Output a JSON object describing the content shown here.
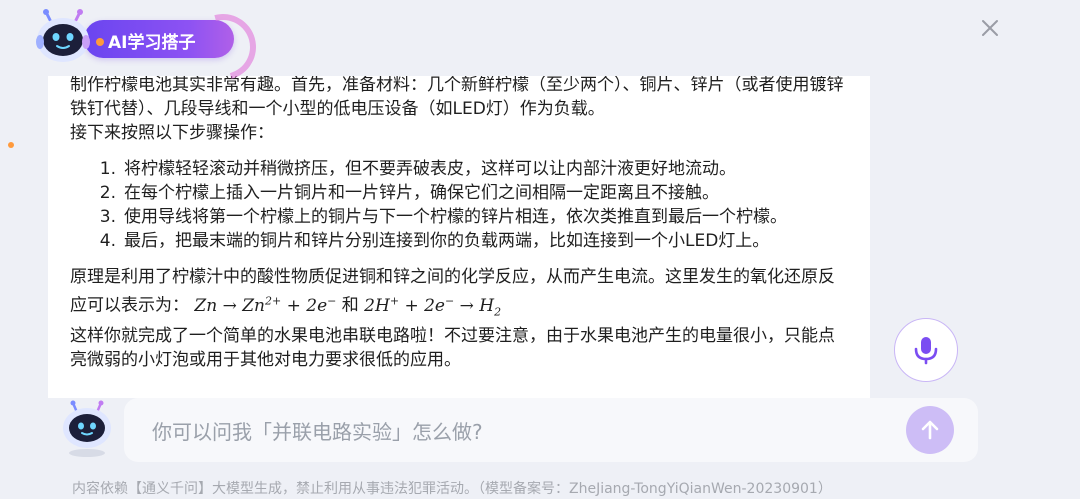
{
  "header": {
    "title": "AI学习搭子",
    "logo_icon": "robot-mascot-icon",
    "close_icon": "close-icon"
  },
  "content": {
    "intro_paragraph": "制作柠檬电池其实非常有趣。首先，准备材料：几个新鲜柠檬（至少两个）、铜片、锌片（或者使用镀锌铁钉代替）、几段导线和一个小型的低电压设备（如LED灯）作为负载。",
    "steps_intro": "接下来按照以下步骤操作：",
    "steps": [
      {
        "num": "1.",
        "text": "将柠檬轻轻滚动并稍微挤压，但不要弄破表皮，这样可以让内部汁液更好地流动。"
      },
      {
        "num": "2.",
        "text": "在每个柠檬上插入一片铜片和一片锌片，确保它们之间相隔一定距离且不接触。"
      },
      {
        "num": "3.",
        "text": "使用导线将第一个柠檬上的铜片与下一个柠檬的锌片相连，依次类推直到最后一个柠檬。"
      },
      {
        "num": "4.",
        "text": "最后，把最末端的铜片和锌片分别连接到你的负载两端，比如连接到一个小LED灯上。"
      }
    ],
    "principle_text": "原理是利用了柠檬汁中的酸性物质促进铜和锌之间的化学反应，从而产生电流。这里发生的氧化还原反应可以表示为：",
    "formula_conjunction": "和",
    "conclusion": "这样你就完成了一个简单的水果电池串联电路啦！不过要注意，由于水果电池产生的电量很小，只能点亮微弱的小灯泡或用于其他对电力要求很低的应用。"
  },
  "input": {
    "placeholder": "你可以问我「并联电路实验」怎么做?",
    "mic_icon": "microphone-icon",
    "send_icon": "arrow-up-icon"
  },
  "footer": {
    "text": "内容依赖【通义千问】大模型生成，禁止利用从事违法犯罪活动。（模型备案号：ZheJiang-TongYiQianWen-20230901）"
  },
  "colors": {
    "accent": "#7b4df2",
    "background": "#eef0f6",
    "send_button": "#cdbdf6"
  }
}
